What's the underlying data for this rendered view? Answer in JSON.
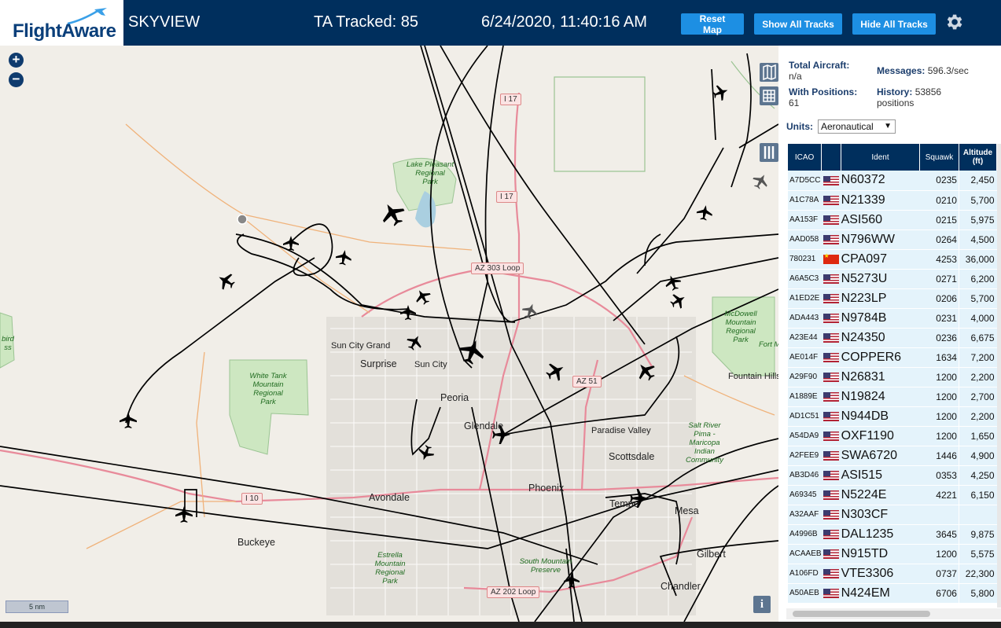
{
  "header": {
    "brand": "FlightAware",
    "site_name": "SKYVIEW",
    "tracked": "TA Tracked: 85",
    "datetime": "6/24/2020, 11:40:16 AM",
    "btn_reset": "Reset Map",
    "btn_show": "Show All Tracks",
    "btn_hide": "Hide All Tracks",
    "settings_icon": "gear-icon"
  },
  "map": {
    "zoom_in": "+",
    "zoom_out": "−",
    "scale": "5 nm",
    "info": "i",
    "labels": {
      "sun_city_grand": "Sun City Grand",
      "surprise": "Surprise",
      "sun_city": "Sun City",
      "peoria": "Peoria",
      "glendale": "Glendale",
      "paradise_valley": "Paradise Valley",
      "scottsdale": "Scottsdale",
      "phoenix": "Phoenix",
      "tempe": "Tempe",
      "mesa": "Mesa",
      "gilbert": "Gilbert",
      "chandler": "Chandler",
      "avondale": "Avondale",
      "buckeye": "Buckeye",
      "fountain_hills": "Fountain Hills",
      "fort_mc": "Fort M",
      "lake_pleasant_1": "Lake Pleasant",
      "lake_pleasant_2": "Regional",
      "lake_pleasant_3": "Park",
      "white_tank_1": "White Tank",
      "white_tank_2": "Mountain",
      "white_tank_3": "Regional",
      "white_tank_4": "Park",
      "mcdowell_1": "McDowell",
      "mcdowell_2": "Mountain",
      "mcdowell_3": "Regional",
      "mcdowell_4": "Park",
      "salt_river_1": "Salt River",
      "salt_river_2": "Pima -",
      "salt_river_3": "Maricopa",
      "salt_river_4": "Indian",
      "salt_river_5": "Community",
      "estrella_1": "Estrella",
      "estrella_2": "Mountain",
      "estrella_3": "Regional",
      "estrella_4": "Park",
      "south_mtn_1": "South Mountain",
      "south_mtn_2": "Preserve",
      "hbird_1": "bird",
      "hbird_2": "ss",
      "i17_a": "I 17",
      "i17_b": "I 17",
      "az303": "AZ 303 Loop",
      "az51": "AZ 51",
      "i10": "I 10",
      "az202": "AZ 202 Loop"
    }
  },
  "panel": {
    "total_aircraft_label": "Total Aircraft:",
    "total_aircraft_value": "n/a",
    "messages_label": "Messages:",
    "messages_value": "596.3/sec",
    "with_positions_label": "With Positions:",
    "with_positions_value": "61",
    "history_label": "History:",
    "history_value": "53856",
    "history_unit": "positions",
    "units_label": "Units:",
    "units_value": "Aeronautical",
    "columns": [
      "ICAO",
      "",
      "Ident",
      "Squawk",
      "Altitude (ft)"
    ],
    "rows": [
      {
        "icao": "A7D5CC",
        "flag": "us",
        "ident": "N60372",
        "squawk": "0235",
        "alt": "2,450"
      },
      {
        "icao": "A1C78A",
        "flag": "us",
        "ident": "N21339",
        "squawk": "0210",
        "alt": "5,700"
      },
      {
        "icao": "AA153F",
        "flag": "us",
        "ident": "ASI560",
        "squawk": "0215",
        "alt": "5,975"
      },
      {
        "icao": "AAD058",
        "flag": "us",
        "ident": "N796WW",
        "squawk": "0264",
        "alt": "4,500"
      },
      {
        "icao": "780231",
        "flag": "cn",
        "ident": "CPA097",
        "squawk": "4253",
        "alt": "36,000"
      },
      {
        "icao": "A6A5C3",
        "flag": "us",
        "ident": "N5273U",
        "squawk": "0271",
        "alt": "6,200"
      },
      {
        "icao": "A1ED2E",
        "flag": "us",
        "ident": "N223LP",
        "squawk": "0206",
        "alt": "5,700"
      },
      {
        "icao": "ADA443",
        "flag": "us",
        "ident": "N9784B",
        "squawk": "0231",
        "alt": "4,000"
      },
      {
        "icao": "A23E44",
        "flag": "us",
        "ident": "N24350",
        "squawk": "0236",
        "alt": "6,675"
      },
      {
        "icao": "AE014F",
        "flag": "us",
        "ident": "COPPER6",
        "squawk": "1634",
        "alt": "7,200"
      },
      {
        "icao": "A29F90",
        "flag": "us",
        "ident": "N26831",
        "squawk": "1200",
        "alt": "2,200"
      },
      {
        "icao": "A1889E",
        "flag": "us",
        "ident": "N19824",
        "squawk": "1200",
        "alt": "2,700"
      },
      {
        "icao": "AD1C51",
        "flag": "us",
        "ident": "N944DB",
        "squawk": "1200",
        "alt": "2,200"
      },
      {
        "icao": "A54DA9",
        "flag": "us",
        "ident": "OXF1190",
        "squawk": "1200",
        "alt": "1,650"
      },
      {
        "icao": "A2FEE9",
        "flag": "us",
        "ident": "SWA6720",
        "squawk": "1446",
        "alt": "4,900"
      },
      {
        "icao": "AB3D46",
        "flag": "us",
        "ident": "ASI515",
        "squawk": "0353",
        "alt": "4,250"
      },
      {
        "icao": "A69345",
        "flag": "us",
        "ident": "N5224E",
        "squawk": "4221",
        "alt": "6,150"
      },
      {
        "icao": "A32AAF",
        "flag": "us",
        "ident": "N303CF",
        "squawk": "",
        "alt": ""
      },
      {
        "icao": "A4996B",
        "flag": "us",
        "ident": "DAL1235",
        "squawk": "3645",
        "alt": "9,875"
      },
      {
        "icao": "ACAAEB",
        "flag": "us",
        "ident": "N915TD",
        "squawk": "1200",
        "alt": "5,575"
      },
      {
        "icao": "A106FD",
        "flag": "us",
        "ident": "VTE3306",
        "squawk": "0737",
        "alt": "22,300"
      },
      {
        "icao": "A50AEB",
        "flag": "us",
        "ident": "N424EM",
        "squawk": "6706",
        "alt": "5,800"
      }
    ]
  },
  "colors": {
    "header_bg": "#002f5d",
    "button": "#1d8fe3",
    "table_row": "#e4f3fb"
  }
}
